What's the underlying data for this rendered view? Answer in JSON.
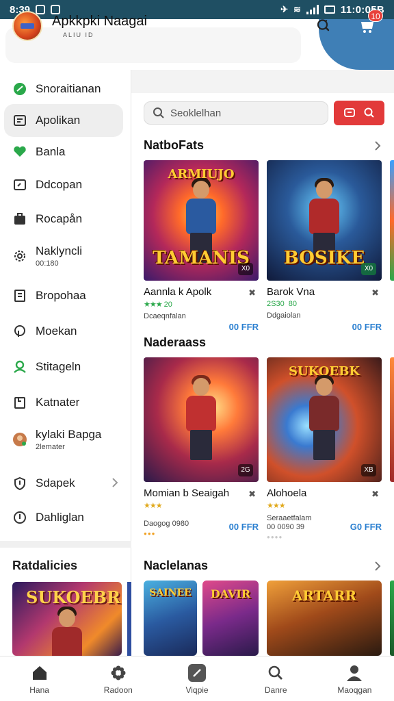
{
  "status_bar": {
    "time": "8:39",
    "right_text": "11:0:05B"
  },
  "header": {
    "app_title": "Apkkpki Naagai",
    "app_subtitle": "ALIU  ID",
    "notification_count": "10",
    "accent_color": "#3f7fb6"
  },
  "sidebar": {
    "items": [
      {
        "label": "Snoraitianan",
        "icon": "chat-icon"
      },
      {
        "label": "Apolikan",
        "icon": "calendar-icon",
        "active": true
      },
      {
        "label": "Banla",
        "icon": "heart-icon"
      },
      {
        "label": "Ddcopan",
        "icon": "window-icon"
      },
      {
        "label": "Rocapån",
        "icon": "bag-icon"
      },
      {
        "label": "Naklyncli",
        "sub": "00:180",
        "icon": "gear-icon"
      },
      {
        "label": "Bropohaa",
        "icon": "document-icon"
      },
      {
        "label": "Moekan",
        "icon": "pin-icon"
      },
      {
        "label": "Stitageln",
        "icon": "user-icon"
      },
      {
        "label": "Katnater",
        "icon": "clipboard-icon"
      },
      {
        "label": "kylaki Bapga",
        "sub": "2lemater",
        "icon": "avatar-icon"
      },
      {
        "label": "Sdapek",
        "icon": "shield-icon",
        "has_chevron": true
      },
      {
        "label": "Dahliglan",
        "icon": "info-icon"
      }
    ],
    "section_title": "Ratdalicies",
    "banner_text": "SUKOEBR"
  },
  "search": {
    "placeholder": "Seoklelhan"
  },
  "sections": [
    {
      "title": "NatboFats",
      "cards": [
        {
          "name": "Aannla k Apolk",
          "rating": "20",
          "rating_stars": "★★★",
          "star_color": "green",
          "developer": "Dcaeqnfalan",
          "price": "00 FFR",
          "art_title": "TAMANIS",
          "art_top": "ARMIUJO",
          "corner": "X0"
        },
        {
          "name": "Barok Vna",
          "rating": "80",
          "rating_prefix": "2S30",
          "developer": "Ddgaiolan",
          "price": "00 FFR",
          "art_title": "BOSIKE",
          "corner": "X0"
        }
      ]
    },
    {
      "title": "Naderaass",
      "cards": [
        {
          "name": "Momian b Seaigah",
          "rating_stars": "★★★",
          "star_color": "gold",
          "developer": "Daogog 0980",
          "price": "00 FFR",
          "corner": "2G"
        },
        {
          "name": "Alohoela",
          "rating_stars": "★★★",
          "star_color": "gold",
          "developer": "Seraaetfalam",
          "developer2": "00 0090 39",
          "price": "G0 FFR",
          "art_top": "SUKOEBK",
          "corner": "XB"
        }
      ]
    },
    {
      "title": "Naclelanas",
      "cards": [
        {
          "art_top": "SAINEE"
        },
        {
          "art_top": "DAVIR"
        },
        {
          "art_top": "ARTARR"
        }
      ]
    }
  ],
  "bottom_nav": [
    {
      "label": "Hana",
      "icon": "home-icon"
    },
    {
      "label": "Radoon",
      "icon": "flower-icon"
    },
    {
      "label": "Viqpie",
      "icon": "compass-icon"
    },
    {
      "label": "Danre",
      "icon": "search-icon"
    },
    {
      "label": "Maoqgan",
      "icon": "profile-icon"
    }
  ]
}
